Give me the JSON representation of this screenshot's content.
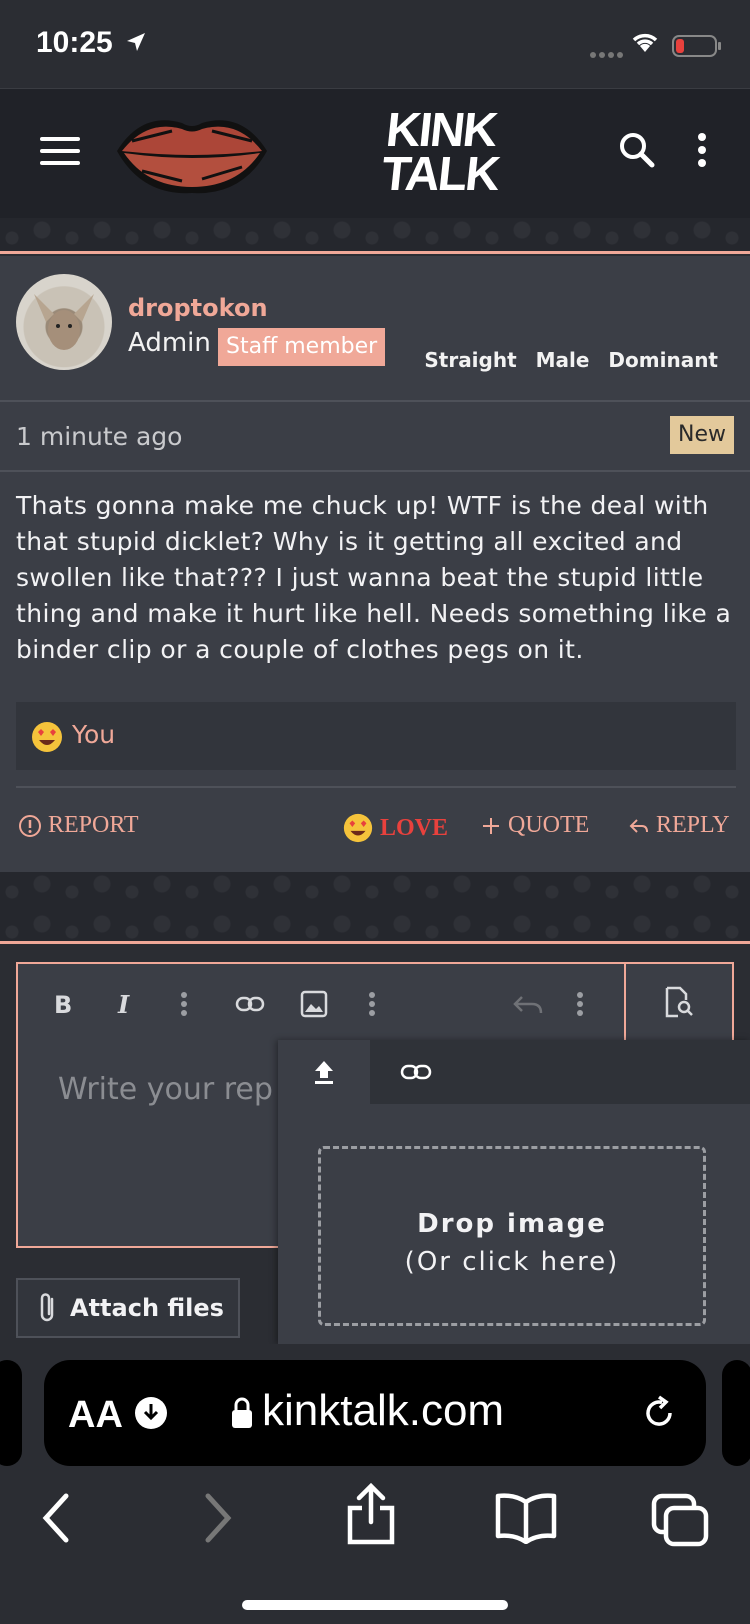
{
  "status_bar": {
    "time": "10:25"
  },
  "header": {
    "logo_text_line1": "KINK",
    "logo_text_line2": "TALK"
  },
  "post": {
    "username": "droptokon",
    "role": "Admin",
    "staff_badge": "Staff member",
    "tags": [
      "Straight",
      "Male",
      "Dominant"
    ],
    "time_ago": "1 minute ago",
    "new_badge": "New",
    "content": "Thats gonna make me chuck up! WTF is the deal with that stupid dicklet? Why is it getting all excited and swollen like that??? I just wanna beat the stupid little thing and make it hurt like hell. Needs something like a binder clip or a couple of clothes pegs on it.",
    "reaction_by": "You",
    "actions": {
      "report": "REPORT",
      "love": "LOVE",
      "quote": "QUOTE",
      "reply": "REPLY"
    }
  },
  "editor": {
    "placeholder": "Write your rep",
    "image_popup": {
      "drop_line1": "Drop image",
      "drop_line2": "(Or click here)"
    },
    "attach_files": "Attach files"
  },
  "browser": {
    "aa_label": "AA",
    "url": "kinktalk.com"
  },
  "colors": {
    "accent": "#f0a898",
    "love": "#e8413d",
    "new_badge": "#e3c99b"
  }
}
